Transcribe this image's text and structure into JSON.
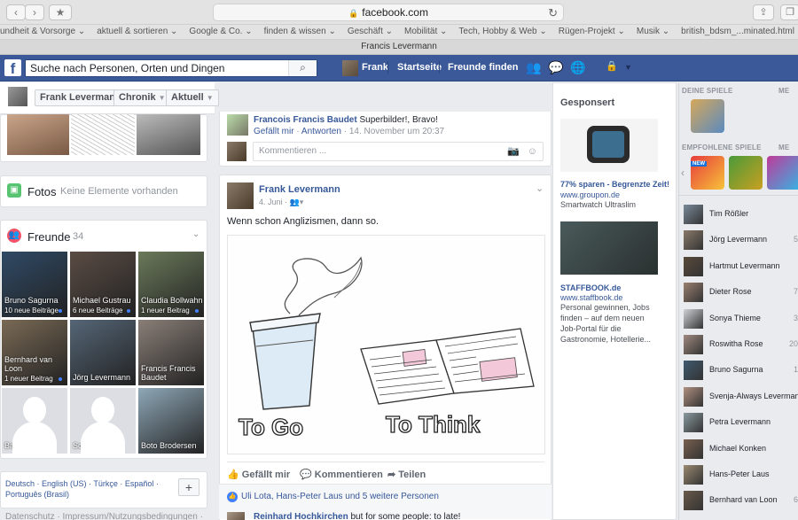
{
  "browser": {
    "url": "facebook.com",
    "tab_title": "Francis Levermann",
    "bookmarks": [
      "undheit & Vorsorge ⌄",
      "aktuell & sortieren ⌄",
      "Google & Co. ⌄",
      "finden & wissen ⌄",
      "Geschäft ⌄",
      "Mobilität ⌄",
      "Tech, Hobby & Web ⌄",
      "Rügen-Projekt ⌄",
      "Musik ⌄",
      "british_bdsm_...minated.html",
      "Welt & Regionen ⌄"
    ]
  },
  "fb_header": {
    "logo": "f",
    "search_placeholder": "Suche nach Personen, Orten und Dingen",
    "user": "Frank",
    "home": "Startseite",
    "find_friends": "Freunde finden"
  },
  "profile_strip": {
    "name": "Frank Levermann",
    "timeline": "Chronik",
    "recent": "Aktuell"
  },
  "left": {
    "photos_title": "Fotos",
    "photos_empty": "Keine Elemente vorhanden",
    "friends_title": "Freunde",
    "friends_count": "34",
    "friends": [
      {
        "name": "Bruno Sagurna",
        "sub": "10 neue Beiträge",
        "dot": true,
        "bg": "#2f4a66"
      },
      {
        "name": "Michael Gustrau",
        "sub": "6 neue Beiträge",
        "dot": true,
        "bg": "#5a4c44"
      },
      {
        "name": "Claudia Bollwahn",
        "sub": "1 neuer Beitrag",
        "dot": true,
        "bg": "#6b7a5a"
      },
      {
        "name": "Bernhard van Loon",
        "sub": "1 neuer Beitrag",
        "dot": true,
        "bg": "#7a6a55"
      },
      {
        "name": "Jörg Levermann",
        "sub": "",
        "dot": false,
        "bg": "#556677"
      },
      {
        "name": "Francis Francis Baudet",
        "sub": "",
        "dot": false,
        "bg": "#8a7f78"
      },
      {
        "name": "Barbara Klask",
        "sub": "",
        "dot": false,
        "bg": "silhouette"
      },
      {
        "name": "Sonya Thieme",
        "sub": "",
        "dot": false,
        "bg": "silhouette"
      },
      {
        "name": "Boto Brodersen",
        "sub": "",
        "dot": false,
        "bg": "#8fa8b8"
      }
    ],
    "languages": "Deutsch · English (US) · Türkçe · Español · Português (Brasil)",
    "add_language": "+",
    "footer": "Datenschutz · Impressum/Nutzungsbedingungen ·"
  },
  "feed": {
    "comment_author": "Francois Francis Baudet",
    "comment_text": "Superbilder!, Bravo!",
    "comment_like": "Gefällt mir",
    "comment_reply": "Antworten",
    "comment_date": "14. November um 20:37",
    "comment_placeholder": "Kommentieren ...",
    "post_author": "Frank Levermann",
    "post_date": "4. Juni ·",
    "post_text": "Wenn schon Anglizismen, dann so.",
    "image_text_left": "To Go",
    "image_text_right": "To Think",
    "like": "Gefällt mir",
    "comment": "Kommentieren",
    "share": "Teilen",
    "likes_summary": "Uli Lota, Hans-Peter Laus und 5 weitere Personen",
    "next_comment_author": "Reinhard Hochkirchen",
    "next_comment_text": "but for some people: to late!"
  },
  "ads": {
    "title": "Gesponsert",
    "ad1_headline": "77% sparen - Begrenzte Zeit!",
    "ad1_domain": "www.groupon.de",
    "ad1_text": "Smartwatch Ultraslim",
    "ad2_headline": "STAFFBOOK.de",
    "ad2_domain": "www.staffbook.de",
    "ad2_text": "Personal gewinnen, Jobs finden – auf dem neuen Job-Portal für die Gastronomie, Hotellerie..."
  },
  "right": {
    "my_games": "DEINE SPIELE",
    "recommended_games": "EMPFOHLENE SPIELE",
    "more": "ME",
    "chat": [
      {
        "name": "Tim Rößler",
        "num": ""
      },
      {
        "name": "Jörg Levermann",
        "num": "5"
      },
      {
        "name": "Hartmut Levermann",
        "num": ""
      },
      {
        "name": "Dieter Rose",
        "num": "7"
      },
      {
        "name": "Sonya Thieme",
        "num": "3"
      },
      {
        "name": "Roswitha Rose",
        "num": "20"
      },
      {
        "name": "Bruno Sagurna",
        "num": "1"
      },
      {
        "name": "Svenja-Always Levermann",
        "num": ""
      },
      {
        "name": "Petra Levermann",
        "num": ""
      },
      {
        "name": "Michael Konken",
        "num": ""
      },
      {
        "name": "Hans-Peter Laus",
        "num": ""
      },
      {
        "name": "Bernhard van Loon",
        "num": "6"
      }
    ]
  }
}
